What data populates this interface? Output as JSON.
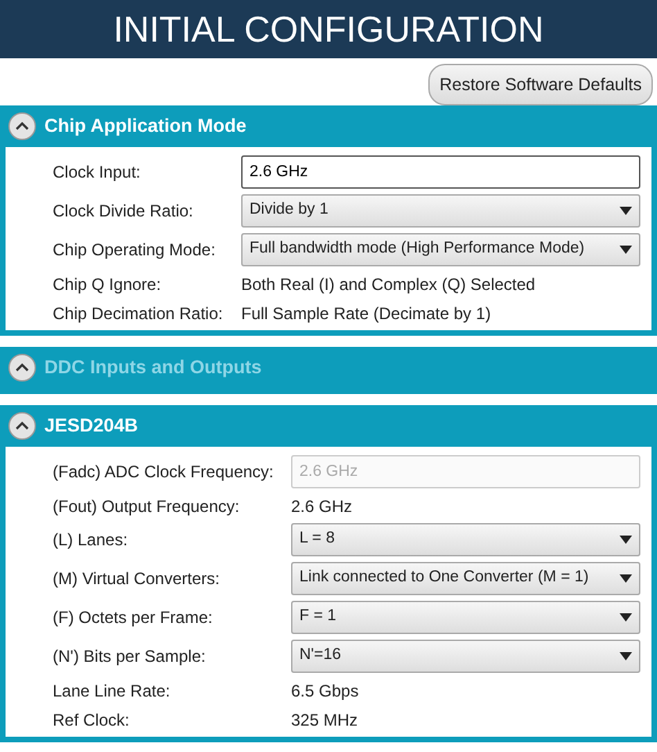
{
  "window": {
    "title": "INITIAL CONFIGURATION"
  },
  "restore_button": "Restore Software Defaults",
  "sections": [
    {
      "title": "Chip Application Mode",
      "expanded": true,
      "disabled": false,
      "fields": [
        {
          "kind": "input",
          "label": "Clock Input:",
          "value": "2.6 GHz",
          "disabled": false
        },
        {
          "kind": "select",
          "label": "Clock Divide Ratio:",
          "value": "Divide by 1"
        },
        {
          "kind": "select",
          "label": "Chip Operating Mode:",
          "value": "Full bandwidth mode (High Performance Mode)"
        },
        {
          "kind": "static",
          "label": "Chip Q Ignore:",
          "value": "Both Real (I) and Complex (Q) Selected"
        },
        {
          "kind": "static",
          "label": "Chip Decimation Ratio:",
          "value": "Full Sample Rate (Decimate by 1)"
        }
      ]
    },
    {
      "title": "DDC Inputs and Outputs",
      "expanded": false,
      "disabled": true
    },
    {
      "title": "JESD204B",
      "expanded": true,
      "disabled": false,
      "fields": [
        {
          "kind": "input",
          "label": "(Fadc) ADC Clock Frequency:",
          "value": "2.6 GHz",
          "disabled": true
        },
        {
          "kind": "static",
          "label": "(Fout) Output Frequency:",
          "value": "2.6 GHz"
        },
        {
          "kind": "select",
          "label": "(L) Lanes:",
          "value": "L = 8"
        },
        {
          "kind": "select",
          "label": "(M) Virtual Converters:",
          "value": "Link connected to One Converter (M = 1)"
        },
        {
          "kind": "select",
          "label": "(F) Octets per Frame:",
          "value": "F = 1"
        },
        {
          "kind": "select",
          "label": "(N') Bits per Sample:",
          "value": "N'=16"
        },
        {
          "kind": "static",
          "label": "Lane Line Rate:",
          "value": "6.5 Gbps"
        },
        {
          "kind": "static",
          "label": "Ref Clock:",
          "value": "325 MHz"
        }
      ]
    }
  ]
}
